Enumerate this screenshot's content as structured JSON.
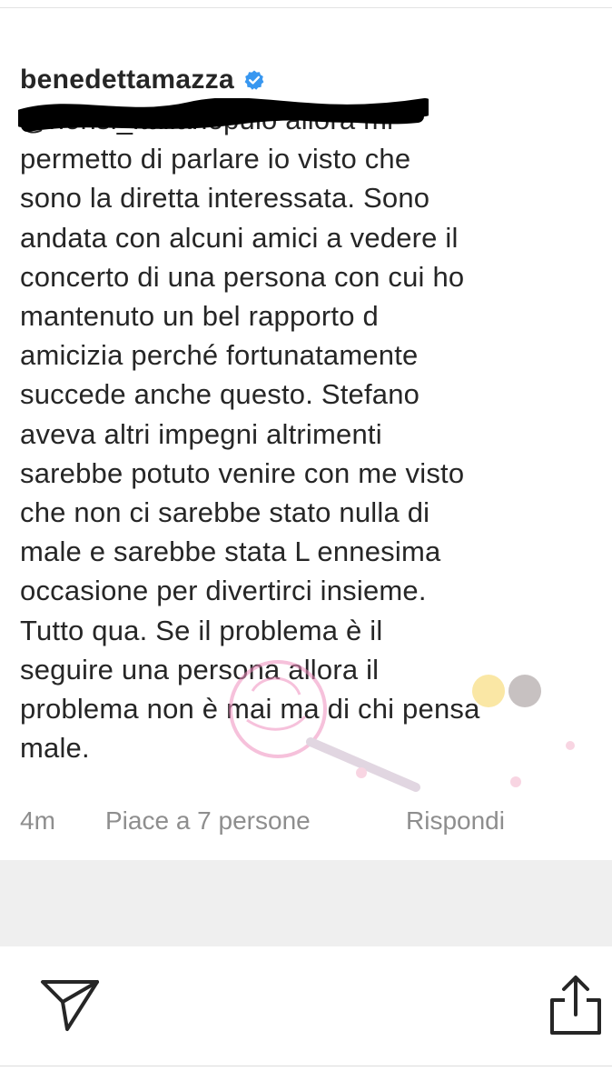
{
  "comment": {
    "username": "benedettamazza",
    "verified_icon": "verified-badge-icon",
    "text": "@nonsi_italianopulo allora mi\npermetto di parlare io visto che\nsono la diretta interessata. Sono\nandata con alcuni amici a vedere il\nconcerto di una persona con cui ho\nmantenuto un bel rapporto d\namicizia perché fortunatamente\nsuccede anche questo. Stefano\naveva altri impegni altrimenti\nsarebbe potuto venire con me visto\nche non ci sarebbe stato nulla di\nmale e sarebbe stata L ennesima\noccasione per divertirci insieme.\nTutto qua. Se il problema è il\nseguire una persona allora il\nproblema non è mai ma di chi pensa\nmale."
  },
  "meta": {
    "time": "4m",
    "likes": "Piace a 7 persone",
    "reply": "Rispondi"
  },
  "bottom_bar": {
    "send_icon": "send-icon",
    "share_icon": "share-icon"
  },
  "colors": {
    "text": "#262626",
    "secondary": "#8e8e8e",
    "verified": "#3897f0",
    "band": "#efefef"
  }
}
